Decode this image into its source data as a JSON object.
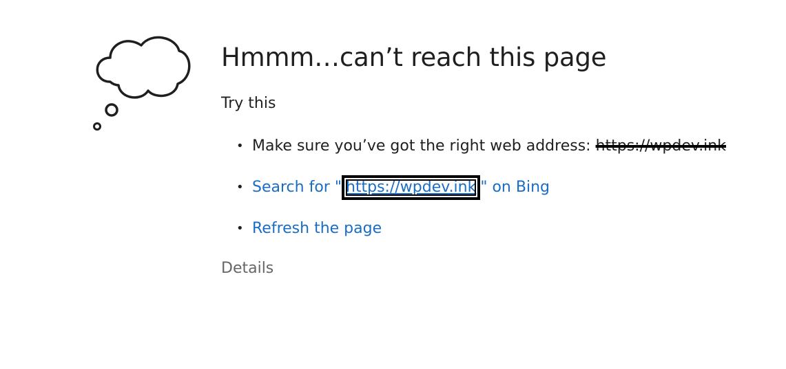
{
  "error": {
    "title": "Hmmm…can’t reach this page",
    "subtitle": "Try this",
    "icon": "thought-cloud-icon"
  },
  "suggestions": {
    "address_prefix": "Make sure you’ve got the right web address: ",
    "address_url": "https://wpdev.ink",
    "search_prefix": "Search for \"",
    "search_url": "https://wpdev.ink",
    "search_suffix": "\" on Bing",
    "refresh": "Refresh the page"
  },
  "details": "Details",
  "colors": {
    "link": "#1a6dc4",
    "text": "#1f1f1f",
    "muted": "#666666"
  }
}
